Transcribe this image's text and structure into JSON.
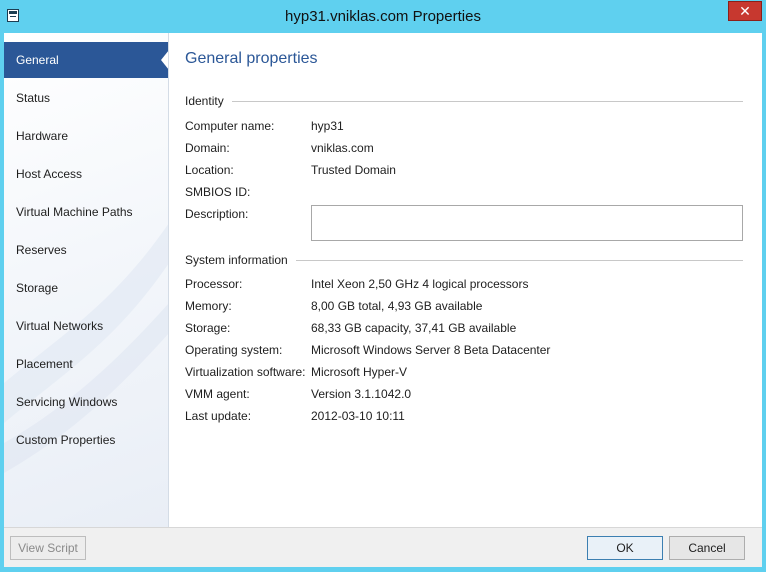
{
  "window": {
    "title": "hyp31.vniklas.com Properties",
    "close_symbol": "✕",
    "accent_color": "#5fd0ef"
  },
  "sidebar": {
    "items": [
      {
        "label": "General",
        "active": true
      },
      {
        "label": "Status"
      },
      {
        "label": "Hardware"
      },
      {
        "label": "Host Access"
      },
      {
        "label": "Virtual Machine Paths"
      },
      {
        "label": "Reserves"
      },
      {
        "label": "Storage"
      },
      {
        "label": "Virtual Networks"
      },
      {
        "label": "Placement"
      },
      {
        "label": "Servicing Windows"
      },
      {
        "label": "Custom Properties"
      }
    ]
  },
  "main": {
    "title": "General properties",
    "identity": {
      "heading": "Identity",
      "fields": [
        {
          "label": "Computer name:",
          "value": "hyp31"
        },
        {
          "label": "Domain:",
          "value": "vniklas.com"
        },
        {
          "label": "Location:",
          "value": "Trusted Domain"
        },
        {
          "label": "SMBIOS ID:",
          "value": ""
        },
        {
          "label": "Description:",
          "value": ""
        }
      ]
    },
    "system": {
      "heading": "System information",
      "fields": [
        {
          "label": "Processor:",
          "value": "Intel Xeon 2,50 GHz 4 logical processors"
        },
        {
          "label": "Memory:",
          "value": "8,00 GB total, 4,93 GB available"
        },
        {
          "label": "Storage:",
          "value": "68,33 GB capacity, 37,41 GB available"
        },
        {
          "label": "Operating system:",
          "value": "Microsoft Windows Server 8 Beta Datacenter"
        },
        {
          "label": "Virtualization software:",
          "value": "Microsoft Hyper-V"
        },
        {
          "label": "VMM agent:",
          "value": "Version 3.1.1042.0"
        },
        {
          "label": "Last update:",
          "value": "2012-03-10 10:11"
        }
      ]
    }
  },
  "footer": {
    "view_script_label": "View Script",
    "ok_label": "OK",
    "cancel_label": "Cancel"
  }
}
